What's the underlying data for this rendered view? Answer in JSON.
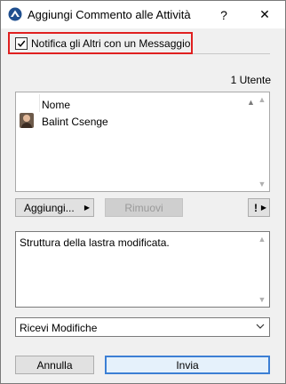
{
  "window": {
    "title": "Aggiungi Commento alle Attività"
  },
  "titlebar": {
    "help_label": "?",
    "close_label": "✕"
  },
  "notify": {
    "label": "Notifica gli Altri con un Messaggio",
    "checked": true
  },
  "users": {
    "count_label": "1 Utente",
    "column_header": "Nome",
    "rows": [
      {
        "name": "Balint Csenge"
      }
    ]
  },
  "actions": {
    "add_label": "Aggiungi...",
    "remove_label": "Rimuovi",
    "more_label": "!"
  },
  "comment": {
    "text": "Struttura della lastra modificata."
  },
  "dropdown": {
    "selected": "Ricevi Modifiche"
  },
  "footer": {
    "cancel_label": "Annulla",
    "ok_label": "Invia"
  },
  "icons": {
    "app": "app-logo-icon",
    "checkbox": "checkmark-icon",
    "avatar": "user-avatar",
    "submenu_arrow": "triangle-right-icon",
    "dropdown_arrow": "chevron-down-icon"
  },
  "colors": {
    "highlight_border": "#e02020",
    "default_button_border": "#3c7fd4"
  }
}
